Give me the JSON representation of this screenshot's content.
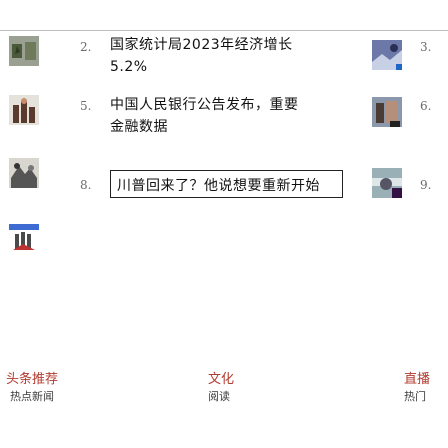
{
  "ranking": {
    "items": [
      {
        "rank": "2.",
        "title": "国家统计局2023年经济增长",
        "title_line2": "5.2%",
        "thumb_icon": "news-thumbnail-icon",
        "side_rank": "3."
      },
      {
        "rank": "5.",
        "title": "中国人民银行公告发布，重要",
        "title_line2": "金融数据",
        "thumb_icon": "news-thumbnail-icon",
        "side_rank": "6."
      },
      {
        "rank": "8.",
        "title": "川普回来了？他说想要重新开始",
        "title_line2": "",
        "thumb_icon": "news-thumbnail-icon",
        "side_rank": "9."
      }
    ],
    "left_numbers": [
      "2.",
      "5.",
      "8."
    ],
    "right_numbers": [
      "3.",
      "6.",
      "9."
    ]
  },
  "bottom_nav": {
    "items": [
      {
        "label": "头条推荐",
        "sub": "热点新闻"
      },
      {
        "label": "文化",
        "sub": "阅读"
      },
      {
        "label": "直播",
        "sub": "热门"
      }
    ]
  },
  "colors": {
    "accent": "#b23b2f",
    "rule": "#bfbfbf"
  }
}
